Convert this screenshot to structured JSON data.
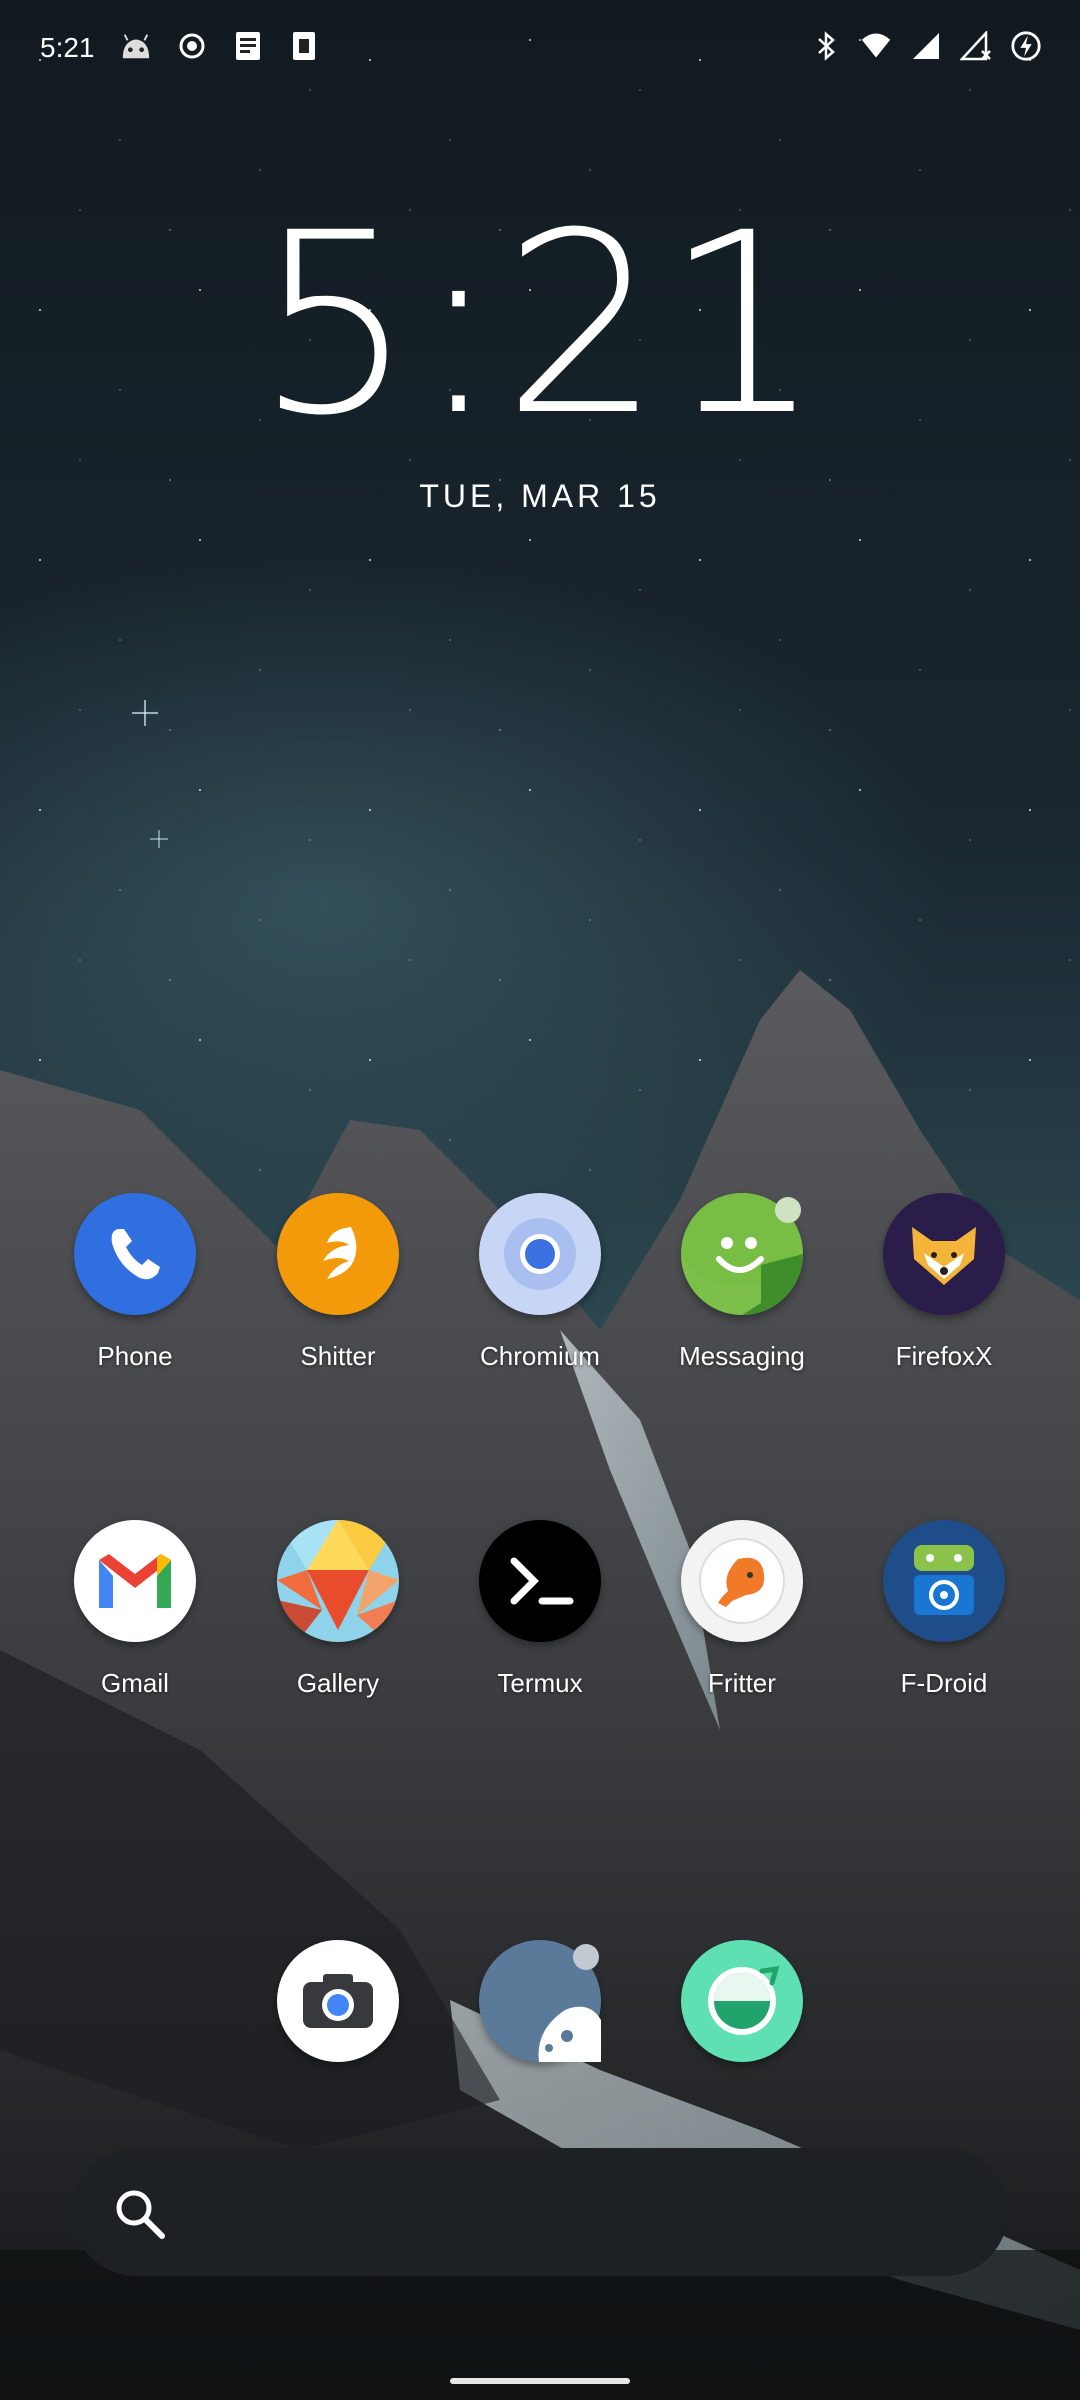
{
  "status_bar": {
    "time": "5:21",
    "left_icons": [
      "android-robot-icon",
      "record-icon",
      "notes-icon",
      "sim-card-icon"
    ],
    "right_icons": [
      "bluetooth-icon",
      "wifi-icon",
      "signal-icon",
      "signal-no-data-icon",
      "battery-charging-icon"
    ]
  },
  "clock": {
    "time": "5:21",
    "date": "TUE, MAR 15"
  },
  "apps_row1": [
    {
      "label": "Phone"
    },
    {
      "label": "Shitter"
    },
    {
      "label": "Chromium"
    },
    {
      "label": "Messaging"
    },
    {
      "label": "FirefoxX"
    }
  ],
  "apps_row2": [
    {
      "label": "Gmail"
    },
    {
      "label": "Gallery"
    },
    {
      "label": "Termux"
    },
    {
      "label": "Fritter"
    },
    {
      "label": "F-Droid"
    }
  ],
  "dock": [
    "camera-icon",
    "moon-app-icon",
    "green-app-icon"
  ],
  "search": {
    "icon": "search-icon"
  },
  "colors": {
    "phone": "#2f6fe0",
    "shitter": "#f39a0b",
    "chromium": "#c7d6f5",
    "messaging": "#7cc04a",
    "firefoxx": "#2a1d4a",
    "termux": "#000000",
    "fdroid": "#1f4d8a"
  }
}
